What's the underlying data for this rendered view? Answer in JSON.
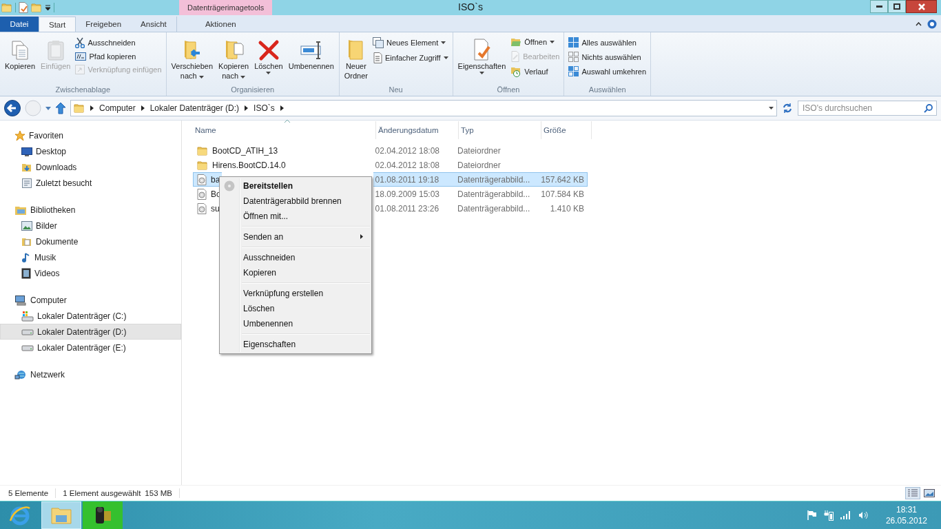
{
  "window": {
    "title": "ISO`s",
    "context_tab_group": "Datenträgerimagetools"
  },
  "ribbon": {
    "tabs": [
      {
        "label": "Datei",
        "kind": "file",
        "selected": false
      },
      {
        "label": "Start",
        "kind": "tab",
        "selected": true
      },
      {
        "label": "Freigeben",
        "kind": "tab",
        "selected": false
      },
      {
        "label": "Ansicht",
        "kind": "tab",
        "selected": false
      },
      {
        "label": "Aktionen",
        "kind": "context",
        "selected": false
      }
    ],
    "groups": [
      {
        "label": "Zwischenablage",
        "large": [
          {
            "lines": [
              "Kopieren"
            ],
            "dropdown": false,
            "disabled": false
          },
          {
            "lines": [
              "Einfügen"
            ],
            "dropdown": false,
            "disabled": true
          }
        ],
        "small": [
          {
            "label": "Ausschneiden",
            "dropdown": false,
            "disabled": false
          },
          {
            "label": "Pfad kopieren",
            "dropdown": false,
            "disabled": false
          },
          {
            "label": "Verknüpfung einfügen",
            "dropdown": false,
            "disabled": true
          }
        ]
      },
      {
        "label": "Organisieren",
        "large": [
          {
            "lines": [
              "Verschieben",
              "nach"
            ],
            "dropdown": true,
            "disabled": false
          },
          {
            "lines": [
              "Kopieren",
              "nach"
            ],
            "dropdown": true,
            "disabled": false
          },
          {
            "lines": [
              "Löschen"
            ],
            "dropdown": true,
            "disabled": false
          },
          {
            "lines": [
              "Umbenennen"
            ],
            "dropdown": false,
            "disabled": false
          }
        ]
      },
      {
        "label": "Neu",
        "large": [
          {
            "lines": [
              "Neuer",
              "Ordner"
            ],
            "dropdown": false,
            "disabled": false
          }
        ],
        "small": [
          {
            "label": "Neues Element",
            "dropdown": true,
            "disabled": false
          },
          {
            "label": "Einfacher Zugriff",
            "dropdown": true,
            "disabled": false
          }
        ]
      },
      {
        "label": "Öffnen",
        "large": [
          {
            "lines": [
              "Eigenschaften"
            ],
            "dropdown": true,
            "disabled": false
          }
        ],
        "small": [
          {
            "label": "Öffnen",
            "dropdown": true,
            "disabled": false
          },
          {
            "label": "Bearbeiten",
            "dropdown": false,
            "disabled": true
          },
          {
            "label": "Verlauf",
            "dropdown": false,
            "disabled": false
          }
        ]
      },
      {
        "label": "Auswählen",
        "small": [
          {
            "label": "Alles auswählen",
            "dropdown": false,
            "disabled": false
          },
          {
            "label": "Nichts auswählen",
            "dropdown": false,
            "disabled": false
          },
          {
            "label": "Auswahl umkehren",
            "dropdown": false,
            "disabled": false
          }
        ]
      }
    ]
  },
  "address_bar": {
    "nav_buttons": [
      {
        "kind": "back",
        "disabled": false
      },
      {
        "kind": "forward",
        "disabled": true
      }
    ],
    "breadcrumb": [
      "Computer",
      "Lokaler Datenträger (D:)",
      "ISO`s"
    ],
    "search": {
      "placeholder": "ISO's durchsuchen"
    }
  },
  "navigation": [
    {
      "label": "Favoriten",
      "kind": "favorites",
      "selected": false,
      "children": [
        {
          "label": "Desktop",
          "kind": "desktop",
          "selected": false
        },
        {
          "label": "Downloads",
          "kind": "downloads",
          "selected": false
        },
        {
          "label": "Zuletzt besucht",
          "kind": "recent",
          "selected": false
        }
      ]
    },
    {
      "label": "Bibliotheken",
      "kind": "libraries",
      "selected": false,
      "children": [
        {
          "label": "Bilder",
          "kind": "pictures",
          "selected": false
        },
        {
          "label": "Dokumente",
          "kind": "documents",
          "selected": false
        },
        {
          "label": "Musik",
          "kind": "music",
          "selected": false
        },
        {
          "label": "Videos",
          "kind": "videos",
          "selected": false
        }
      ]
    },
    {
      "label": "Computer",
      "kind": "computer",
      "selected": false,
      "children": [
        {
          "label": "Lokaler Datenträger (C:)",
          "kind": "system_drive",
          "selected": false
        },
        {
          "label": "Lokaler Datenträger (D:)",
          "kind": "drive",
          "selected": true
        },
        {
          "label": "Lokaler Datenträger (E:)",
          "kind": "drive",
          "selected": false
        }
      ]
    },
    {
      "label": "Netzwerk",
      "kind": "network",
      "selected": false
    }
  ],
  "file_list": {
    "columns": [
      {
        "label": "Name",
        "sorted": true
      },
      {
        "label": "Änderungsdatum",
        "sorted": false
      },
      {
        "label": "Typ",
        "sorted": false
      },
      {
        "label": "Größe",
        "sorted": false
      }
    ],
    "rows": [
      {
        "kind": "folder",
        "name": "BootCD_ATIH_13",
        "date": "02.04.2012 18:08",
        "type": "Dateiordner",
        "selected": false
      },
      {
        "kind": "folder",
        "name": "Hirens.BootCD.14.0",
        "date": "02.04.2012 18:08",
        "type": "Dateiordner",
        "selected": false
      },
      {
        "kind": "disc_image",
        "name": "ba",
        "date": "01.08.2011 19:18",
        "type": "Datenträgerabbild...",
        "size": "157.642 KB",
        "selected": true
      },
      {
        "kind": "disc_image",
        "name": "Bo",
        "date": "18.09.2009 15:03",
        "type": "Datenträgerabbild...",
        "size": "107.584 KB",
        "selected": false
      },
      {
        "kind": "disc_image",
        "name": "su",
        "date": "01.08.2011 23:26",
        "type": "Datenträgerabbild...",
        "size": "1.410 KB",
        "selected": false
      }
    ]
  },
  "context_menu": [
    {
      "kind": "item",
      "label": "Bereitstellen",
      "bold": true,
      "submenu": false
    },
    {
      "kind": "item",
      "label": "Datenträgerabbild brennen",
      "bold": false,
      "submenu": false
    },
    {
      "kind": "item",
      "label": "Öffnen mit...",
      "bold": false,
      "submenu": false
    },
    {
      "kind": "separator"
    },
    {
      "kind": "item",
      "label": "Senden an",
      "bold": false,
      "submenu": true
    },
    {
      "kind": "separator"
    },
    {
      "kind": "item",
      "label": "Ausschneiden",
      "bold": false,
      "submenu": false
    },
    {
      "kind": "item",
      "label": "Kopieren",
      "bold": false,
      "submenu": false
    },
    {
      "kind": "separator"
    },
    {
      "kind": "item",
      "label": "Verknüpfung erstellen",
      "bold": false,
      "submenu": false
    },
    {
      "kind": "item",
      "label": "Löschen",
      "bold": false,
      "submenu": false
    },
    {
      "kind": "item",
      "label": "Umbenennen",
      "bold": false,
      "submenu": false
    },
    {
      "kind": "separator"
    },
    {
      "kind": "item",
      "label": "Eigenschaften",
      "bold": false,
      "submenu": false
    }
  ],
  "status_bar": {
    "count": "5 Elemente",
    "selection": "1 Element ausgewählt",
    "size": "153 MB",
    "view_buttons": [
      {
        "kind": "details",
        "selected": true
      },
      {
        "kind": "thumbnails",
        "selected": false
      }
    ]
  },
  "taskbar": {
    "apps": [
      {
        "kind": "browser",
        "selected": false
      },
      {
        "kind": "explorer",
        "selected": true
      },
      {
        "kind": "camera",
        "selected": false
      }
    ],
    "time": "18:31",
    "date": "26.05.2012"
  }
}
